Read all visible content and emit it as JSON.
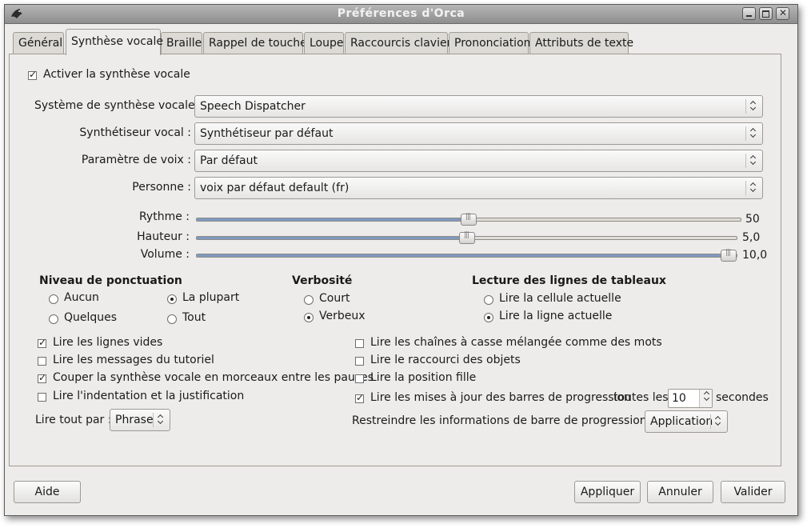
{
  "window": {
    "title": "Préférences d'Orca"
  },
  "tabs": [
    {
      "label": "Général",
      "active": false
    },
    {
      "label": "Synthèse vocale",
      "active": true
    },
    {
      "label": "Braille",
      "active": false
    },
    {
      "label": "Rappel de touche",
      "active": false
    },
    {
      "label": "Loupe",
      "active": false
    },
    {
      "label": "Raccourcis clavier",
      "active": false
    },
    {
      "label": "Prononciation",
      "active": false
    },
    {
      "label": "Attributs de texte",
      "active": false
    }
  ],
  "enable_speech": {
    "label": "Activer la synthèse vocale",
    "checked": true
  },
  "speech_system": {
    "label": "Système de synthèse vocale :",
    "value": "Speech Dispatcher"
  },
  "synthesizer": {
    "label": "Synthétiseur vocal :",
    "value": "Synthétiseur par défaut"
  },
  "voice_setting": {
    "label": "Paramètre de voix :",
    "value": "Par défaut"
  },
  "person": {
    "label": "Personne :",
    "value": "voix par défaut default (fr)"
  },
  "rate": {
    "label": "Rythme :",
    "value": "50",
    "fraction": 0.5
  },
  "pitch": {
    "label": "Hauteur :",
    "value": "5,0",
    "fraction": 0.5
  },
  "volume": {
    "label": "Volume :",
    "value": "10,0",
    "fraction": 1.0
  },
  "punctuation": {
    "heading": "Niveau de ponctuation",
    "options": [
      {
        "label": "Aucun",
        "selected": false
      },
      {
        "label": "La plupart",
        "selected": true
      },
      {
        "label": "Quelques",
        "selected": false
      },
      {
        "label": "Tout",
        "selected": false
      }
    ]
  },
  "verbosity": {
    "heading": "Verbosité",
    "options": [
      {
        "label": "Court",
        "selected": false
      },
      {
        "label": "Verbeux",
        "selected": true
      }
    ]
  },
  "table_rows": {
    "heading": "Lecture des lignes de tableaux",
    "options": [
      {
        "label": "Lire la cellule actuelle",
        "selected": false
      },
      {
        "label": "Lire la ligne actuelle",
        "selected": true
      }
    ]
  },
  "options_left": [
    {
      "label": "Lire les lignes vides",
      "checked": true
    },
    {
      "label": "Lire les messages du tutoriel",
      "checked": false
    },
    {
      "label": "Couper la synthèse vocale en morceaux entre les pauses",
      "checked": true
    },
    {
      "label": "Lire l'indentation et la justification",
      "checked": false
    }
  ],
  "options_right": [
    {
      "label": "Lire les chaînes à casse mélangée comme des mots",
      "checked": false
    },
    {
      "label": "Lire le raccourci des objets",
      "checked": false
    },
    {
      "label": "Lire la position fille",
      "checked": false
    }
  ],
  "progress_updates": {
    "label": "Lire les mises à jour des barres de progression",
    "checked": true,
    "every_label": "toutes les",
    "interval": "10",
    "unit": "secondes"
  },
  "say_all": {
    "label": "Lire tout par :",
    "value": "Phrase"
  },
  "progress_restrict": {
    "label": "Restreindre les informations de barre de progression à :",
    "value": "Application"
  },
  "buttons": {
    "help": "Aide",
    "apply": "Appliquer",
    "cancel": "Annuler",
    "ok": "Valider"
  }
}
